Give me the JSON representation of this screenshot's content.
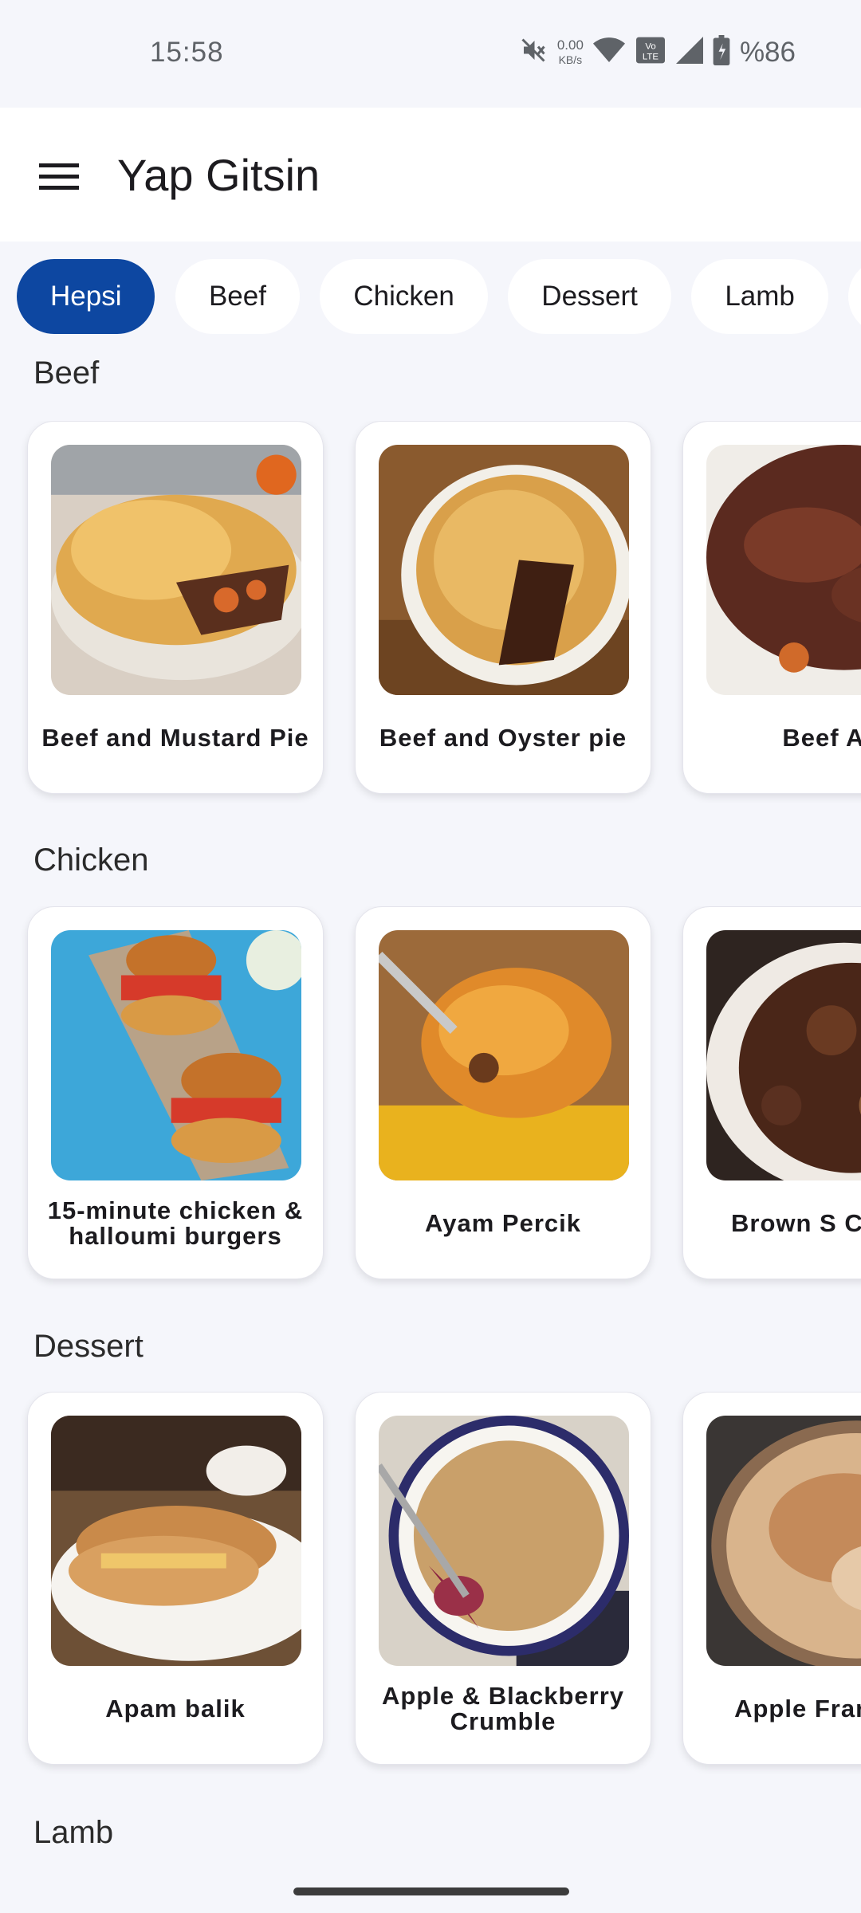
{
  "status_bar": {
    "time": "15:58",
    "speed_value": "0.00",
    "speed_unit": "KB/s",
    "battery": "%86",
    "icons": [
      "mute-icon",
      "wifi-icon",
      "volte-icon",
      "signal-icon",
      "battery-icon"
    ]
  },
  "app_bar": {
    "title": "Yap Gitsin",
    "menu_icon": "menu-icon"
  },
  "filters": [
    "Hepsi",
    "Beef",
    "Chicken",
    "Dessert",
    "Lamb"
  ],
  "selected_filter": "Hepsi",
  "sections": [
    {
      "title": "Beef",
      "recipes": [
        {
          "name": "Beef and Mustard Pie"
        },
        {
          "name": "Beef and Oyster pie"
        },
        {
          "name": "Beef As"
        }
      ]
    },
    {
      "title": "Chicken",
      "recipes": [
        {
          "name": "15-minute chicken & halloumi burgers"
        },
        {
          "name": "Ayam Percik"
        },
        {
          "name": "Brown S Chicke"
        }
      ]
    },
    {
      "title": "Dessert",
      "recipes": [
        {
          "name": "Apam balik"
        },
        {
          "name": "Apple & Blackberry Crumble"
        },
        {
          "name": "Apple Fran Tart"
        }
      ]
    },
    {
      "title": "Lamb",
      "recipes": []
    }
  ],
  "colors": {
    "accent": "#0d47a1",
    "background": "#f5f6fb",
    "card": "#ffffff"
  }
}
